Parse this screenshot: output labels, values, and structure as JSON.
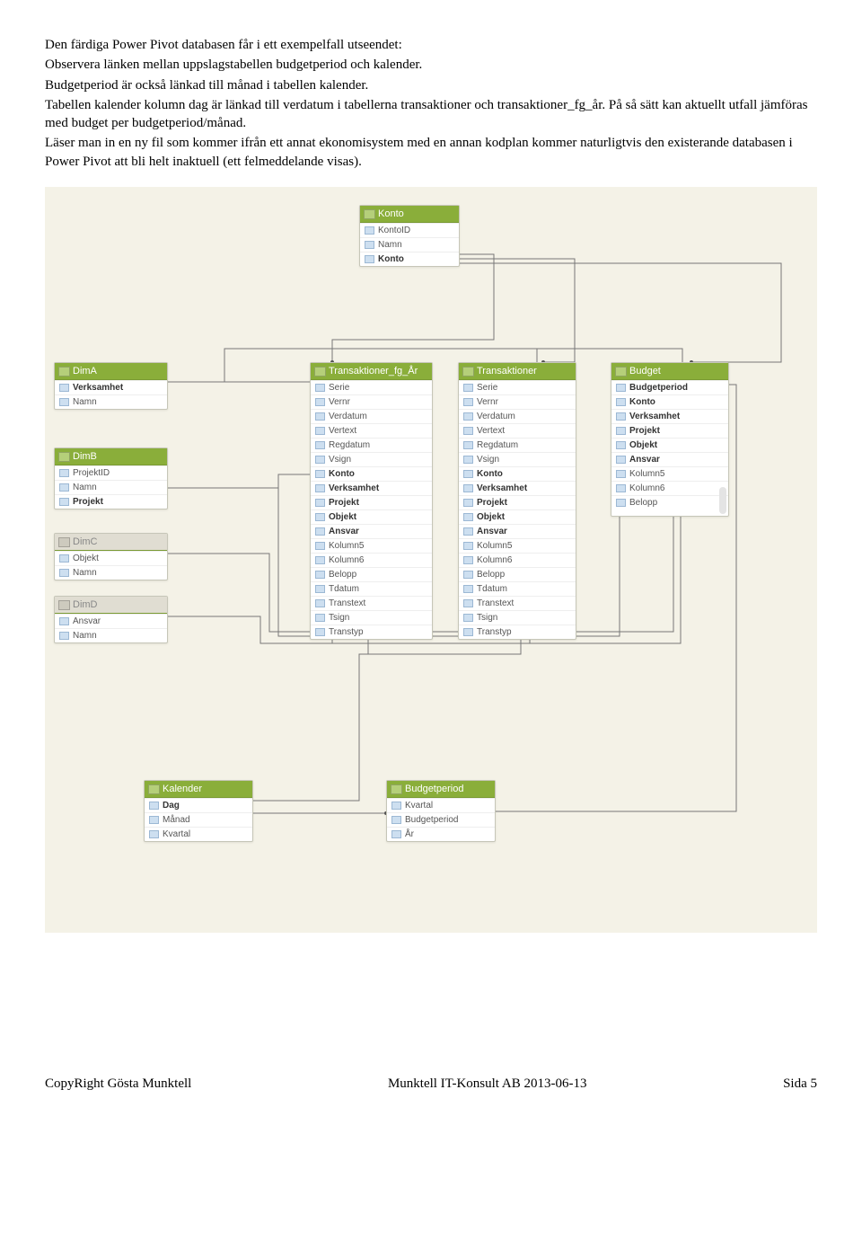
{
  "paragraphs": {
    "p1": "Den färdiga Power Pivot databasen får i ett exempelfall utseendet:",
    "p2": "Observera länken mellan uppslagstabellen budgetperiod och kalender.",
    "p3": "Budgetperiod är också länkad till månad i tabellen kalender.",
    "p4": "Tabellen kalender kolumn dag är länkad till verdatum i tabellerna transaktioner och transaktioner_fg_år. På så sätt kan aktuellt utfall jämföras med budget per budgetperiod/månad.",
    "p5": "Läser man in en ny fil som kommer ifrån ett annat ekonomisystem med en annan kodplan kommer naturligtvis den existerande databasen i Power Pivot att bli helt inaktuell (ett felmeddelande visas)."
  },
  "tables": {
    "konto": {
      "title": "Konto",
      "fields": [
        "KontoID",
        "Namn",
        "Konto"
      ],
      "keys": [
        "Konto"
      ]
    },
    "dimA": {
      "title": "DimA",
      "fields": [
        "Verksamhet",
        "Namn"
      ],
      "keys": [
        "Verksamhet"
      ]
    },
    "dimB": {
      "title": "DimB",
      "fields": [
        "ProjektID",
        "Namn",
        "Projekt"
      ],
      "keys": [
        "Projekt"
      ]
    },
    "dimC": {
      "title": "DimC",
      "fields": [
        "Objekt",
        "Namn"
      ],
      "keys": []
    },
    "dimD": {
      "title": "DimD",
      "fields": [
        "Ansvar",
        "Namn"
      ],
      "keys": []
    },
    "trans_fg": {
      "title": "Transaktioner_fg_År",
      "fields": [
        "Serie",
        "Vernr",
        "Verdatum",
        "Vertext",
        "Regdatum",
        "Vsign",
        "Konto",
        "Verksamhet",
        "Projekt",
        "Objekt",
        "Ansvar",
        "Kolumn5",
        "Kolumn6",
        "Belopp",
        "Tdatum",
        "Transtext",
        "Tsign",
        "Transtyp"
      ],
      "keys": [
        "Konto",
        "Verksamhet",
        "Projekt",
        "Objekt",
        "Ansvar"
      ]
    },
    "trans": {
      "title": "Transaktioner",
      "fields": [
        "Serie",
        "Vernr",
        "Verdatum",
        "Vertext",
        "Regdatum",
        "Vsign",
        "Konto",
        "Verksamhet",
        "Projekt",
        "Objekt",
        "Ansvar",
        "Kolumn5",
        "Kolumn6",
        "Belopp",
        "Tdatum",
        "Transtext",
        "Tsign",
        "Transtyp"
      ],
      "keys": [
        "Konto",
        "Verksamhet",
        "Projekt",
        "Objekt",
        "Ansvar"
      ]
    },
    "budget": {
      "title": "Budget",
      "fields": [
        "Budgetperiod",
        "Konto",
        "Verksamhet",
        "Projekt",
        "Objekt",
        "Ansvar",
        "Kolumn5",
        "Kolumn6",
        "Belopp"
      ],
      "keys": [
        "Budgetperiod",
        "Konto",
        "Verksamhet",
        "Projekt",
        "Objekt",
        "Ansvar"
      ]
    },
    "kalender": {
      "title": "Kalender",
      "fields": [
        "Dag",
        "Månad",
        "Kvartal"
      ],
      "keys": [
        "Dag"
      ]
    },
    "budgetperiod": {
      "title": "Budgetperiod",
      "fields": [
        "Kvartal",
        "Budgetperiod",
        "År"
      ],
      "keys": []
    }
  },
  "footer": {
    "left": "CopyRight Gösta Munktell",
    "center": "Munktell IT-Konsult AB 2013-06-13",
    "right": "Sida 5"
  }
}
